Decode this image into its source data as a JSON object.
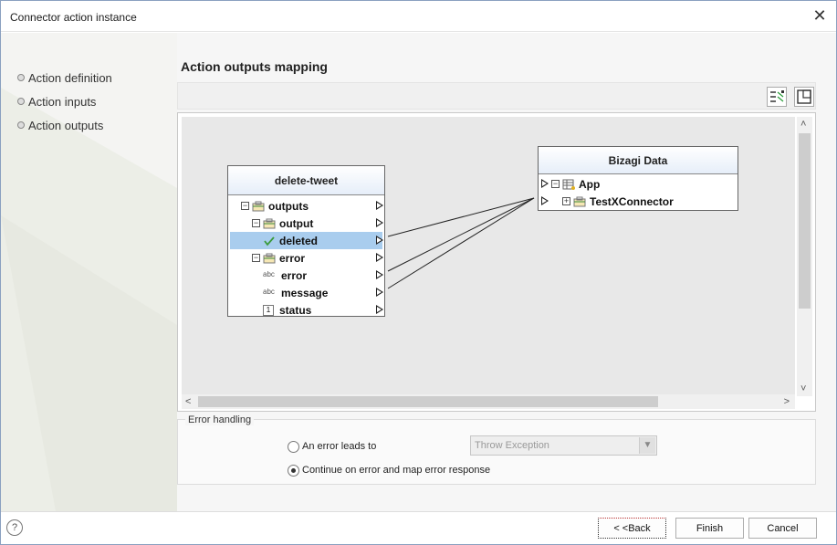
{
  "window": {
    "title": "Connector action instance",
    "close_glyph": "✕"
  },
  "nav": {
    "items": [
      {
        "label": "Action definition"
      },
      {
        "label": "Action inputs"
      },
      {
        "label": "Action outputs"
      }
    ]
  },
  "main": {
    "section_title": "Action outputs mapping",
    "toolbar": {
      "icons": [
        "auto-map-icon",
        "fit-view-icon"
      ]
    }
  },
  "diagram": {
    "source": {
      "title": "delete-tweet",
      "rows": [
        {
          "label": "outputs",
          "type": "object",
          "expander": "−"
        },
        {
          "label": "output",
          "type": "object",
          "expander": "−"
        },
        {
          "label": "deleted",
          "type": "boolean",
          "selected": true
        },
        {
          "label": "error",
          "type": "object",
          "expander": "−"
        },
        {
          "label": "error",
          "type": "string",
          "type_text": "abc"
        },
        {
          "label": "message",
          "type": "string",
          "type_text": "abc"
        },
        {
          "label": "status",
          "type": "number",
          "type_text": "1"
        }
      ]
    },
    "target": {
      "title": "Bizagi Data",
      "rows": [
        {
          "label": "App",
          "type": "entity",
          "expander": "−"
        },
        {
          "label": "TestXConnector",
          "type": "object",
          "expander": "+"
        }
      ]
    }
  },
  "error_handling": {
    "legend": "Error handling",
    "option_error": "An error leads to",
    "option_continue": "Continue on error and map error response",
    "selected": "continue",
    "select_value": "Throw Exception"
  },
  "footer": {
    "help_glyph": "?",
    "back_label": "< <Back",
    "finish_label": "Finish",
    "cancel_label": "Cancel"
  },
  "colors": {
    "selection": "#a9cdee",
    "accent": "#1e6fbf"
  }
}
